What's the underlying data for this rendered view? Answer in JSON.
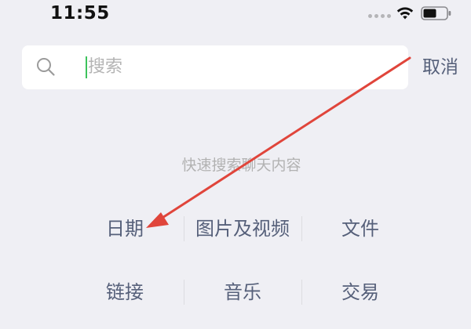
{
  "status_bar": {
    "time": "11:55",
    "icons": [
      "signal-dots-icon",
      "wifi-icon",
      "battery-icon"
    ]
  },
  "search": {
    "placeholder": "搜索",
    "cancel_label": "取消",
    "icon": "search-icon",
    "caret_color": "#3cc35c"
  },
  "hint": "快速搜索聊天内容",
  "categories": [
    {
      "label": "日期"
    },
    {
      "label": "图片及视频"
    },
    {
      "label": "文件"
    },
    {
      "label": "链接"
    },
    {
      "label": "音乐"
    },
    {
      "label": "交易"
    }
  ],
  "annotation": {
    "type": "arrow",
    "color": "#e0453b",
    "points_to": "日期"
  },
  "colors": {
    "background": "#efeff4",
    "link": "#56607a",
    "hint": "#b2b2b2"
  }
}
